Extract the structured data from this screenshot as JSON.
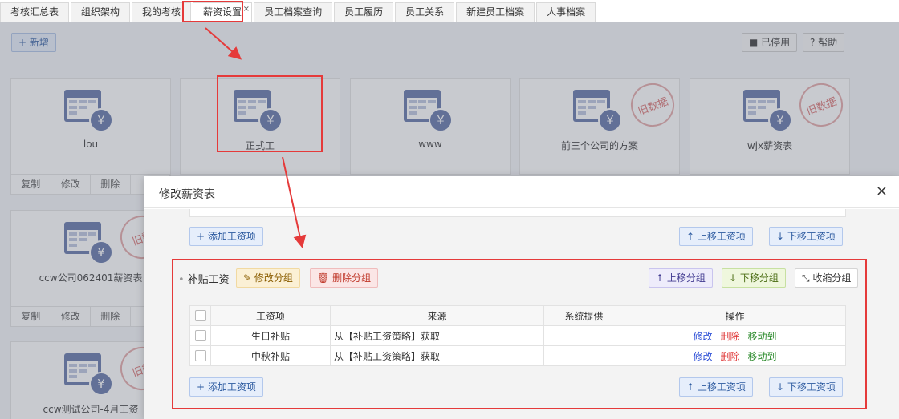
{
  "tabs": [
    {
      "label": "考核汇总表"
    },
    {
      "label": "组织架构"
    },
    {
      "label": "我的考核"
    },
    {
      "label": "薪资设置",
      "active": true,
      "close": "×"
    },
    {
      "label": "员工档案查询"
    },
    {
      "label": "员工履历"
    },
    {
      "label": "员工关系"
    },
    {
      "label": "新建员工档案"
    },
    {
      "label": "人事档案"
    }
  ],
  "toolbar": {
    "add": "+ 新增",
    "disabled": "■ 已停用",
    "help": "? 帮助"
  },
  "cards": [
    {
      "title": "lou",
      "stamp": ""
    },
    {
      "title": "正式工",
      "stamp": ""
    },
    {
      "title": "www",
      "stamp": ""
    },
    {
      "title": "前三个公司的方案",
      "stamp": "旧数据"
    },
    {
      "title": "wjx薪资表",
      "stamp": "旧数据"
    },
    {
      "title": "ccw公司062401薪资表",
      "stamp": "旧数"
    },
    {
      "title": "ccw测试公司-4月工资",
      "stamp": "旧数"
    }
  ],
  "card_actions": {
    "copy": "复制",
    "edit": "修改",
    "delete": "删除"
  },
  "colors": {
    "accent": "#2c5aa0",
    "highlight": "#e53a3a"
  },
  "modal": {
    "title": "修改薪资表",
    "close": "×",
    "add_item": "+ 添加工资项",
    "move_item_up": "↑ 上移工资项",
    "move_item_down": "↓ 下移工资项",
    "group": {
      "bullet": "•",
      "name": "补贴工资",
      "edit": "修改分组",
      "delete": "删除分组",
      "move_up": "上移分组",
      "move_down": "下移分组",
      "collapse": "收缩分组"
    },
    "table": {
      "headers": [
        "工资项",
        "来源",
        "系统提供",
        "操作"
      ],
      "rows": [
        {
          "item": "生日补贴",
          "source": "从【补贴工资策略】获取",
          "system": ""
        },
        {
          "item": "中秋补贴",
          "source": "从【补贴工资策略】获取",
          "system": ""
        }
      ],
      "ops": {
        "edit": "修改",
        "delete": "删除",
        "move": "移动到"
      }
    }
  }
}
